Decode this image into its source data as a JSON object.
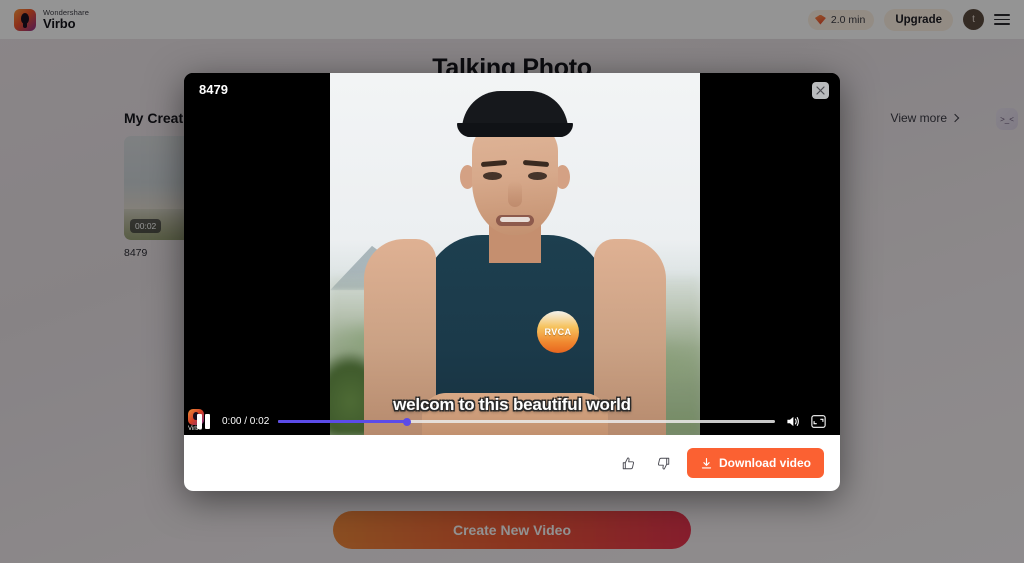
{
  "topbar": {
    "brand_sub": "Wondershare",
    "brand_name": "Virbo",
    "credits": "2.0 min",
    "upgrade_label": "Upgrade",
    "avatar_initial": "t"
  },
  "page": {
    "title": "Talking Photo",
    "creations_title": "My Creations",
    "view_more_label": "View more",
    "side_badge_glyph": ">_<",
    "create_button_label": "Create New Video",
    "cards": [
      {
        "name": "8479",
        "duration": "00:02"
      }
    ]
  },
  "modal": {
    "title": "8479",
    "close_label": "×",
    "subtitle": "welcom to this beautiful world",
    "watermark_text": "Virbo",
    "shirt_logo": "RVCA",
    "player": {
      "time": "0:00 / 0:02",
      "progress_percent": 26,
      "state": "playing"
    },
    "footer": {
      "download_label": "Download video"
    }
  },
  "colors": {
    "accent_orange": "#fb6132",
    "progress_purple": "#5b4be8",
    "upgrade_bg": "#fdf1e3"
  }
}
